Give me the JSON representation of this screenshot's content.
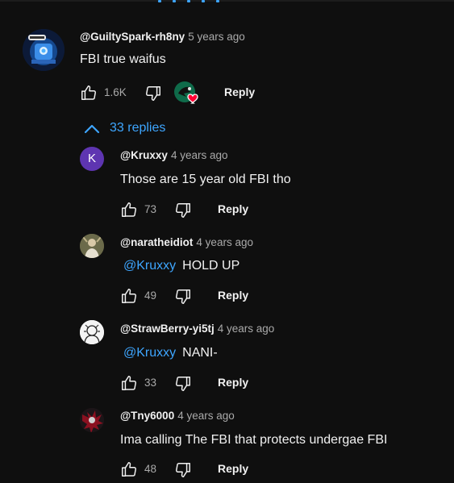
{
  "top_comment": {
    "author": "@GuiltySpark-rh8ny",
    "time": "5 years ago",
    "text": "FBI true waifus",
    "likes": "1.6K",
    "reply_label": "Reply",
    "avatar_icon": "robot-avatar",
    "creator_heart_icon": "creator-heart-badge"
  },
  "replies_toggle": {
    "label": "33 replies",
    "icon": "chevron-up-icon"
  },
  "replies": [
    {
      "author": "@Kruxxy",
      "time": "4 years ago",
      "mention": "",
      "text": "Those are 15 year old FBI tho",
      "likes": "73",
      "reply_label": "Reply",
      "avatar_letter": "K",
      "avatar_color": "#5e35b1"
    },
    {
      "author": "@naratheidiot",
      "time": "4 years ago",
      "mention": "@Kruxxy",
      "text": "HOLD UP",
      "likes": "49",
      "reply_label": "Reply"
    },
    {
      "author": "@StrawBerry-yi5tj",
      "time": "4 years ago",
      "mention": "@Kruxxy",
      "text": "NANI-",
      "likes": "33",
      "reply_label": "Reply"
    },
    {
      "author": "@Tny6000",
      "time": "4 years ago",
      "mention": "",
      "text": "Ima calling The FBI that protects undergae FBI",
      "likes": "48",
      "reply_label": "Reply"
    }
  ],
  "colors": {
    "background": "#0f0f0f",
    "link": "#3ea6ff",
    "secondary_text": "#aaaaaa",
    "heart": "#ff0033"
  }
}
